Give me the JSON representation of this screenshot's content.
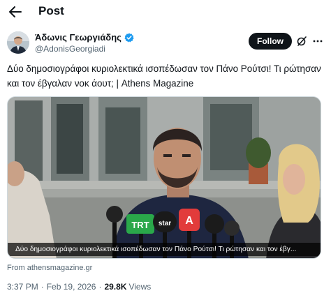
{
  "header": {
    "title": "Post"
  },
  "author": {
    "display_name": "Άδωνις Γεωργιάδης",
    "handle": "@AdonisGeorgiadi",
    "verified": true
  },
  "actions": {
    "follow_label": "Follow"
  },
  "post": {
    "text": "Δύο δημοσιογράφοι κυριολεκτικά ισοπέδωσαν τον Πάνο Ρούτσι! Τι ρώτησαν και τον έβγαλαν νοκ άουτ; | Athens Magazine",
    "media_caption": "Δύο δημοσιογράφοι κυριολεκτικά ισοπέδωσαν τον Πάνο Ρούτσι! Τι ρώτησαν και τον έβγ...",
    "source": "From athensmagazine.gr",
    "time": "3:37 PM",
    "date": "Feb 19, 2026",
    "views_count": "29.8K",
    "views_label": "Views"
  },
  "media_logos": {
    "trt": "TRT",
    "star": "star",
    "a": "A"
  },
  "colors": {
    "follow_bg": "#0f1419",
    "verified_blue": "#1d9bf0",
    "secondary_text": "#536471"
  }
}
